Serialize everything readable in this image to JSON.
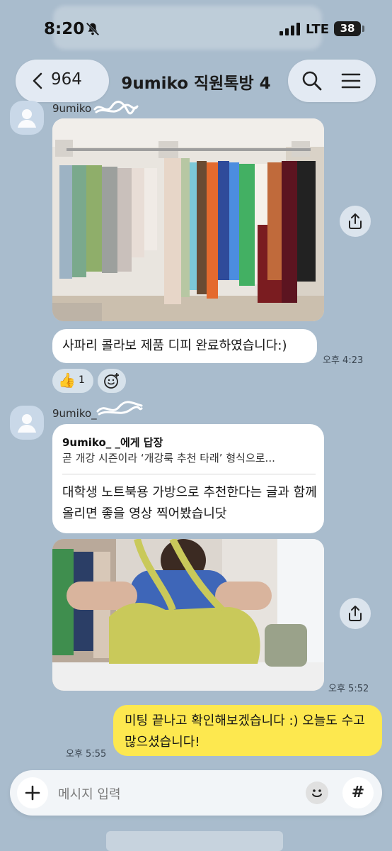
{
  "status_bar": {
    "time": "8:20",
    "network": "LTE",
    "battery": "38"
  },
  "header": {
    "back_count": "964",
    "title": "9umiko 직원톡방 4"
  },
  "messages": {
    "msg1": {
      "sender": "9umiko",
      "text": "사파리 콜라보 제품 디피 완료하였습니다:)",
      "time": "오후 4:23",
      "reaction": {
        "emoji": "👍",
        "count": "1"
      }
    },
    "msg2": {
      "sender": "9umiko_",
      "reply_to": "9umiko_     _에게 답장",
      "reply_quote": "곧 개강 시즌이라 ‘개강룩 추천 타래’ 형식으로...",
      "text": "대학생 노트북용 가방으로 추천한다는 글과 함께 올리면 좋을 영상 찍어봤습니닷",
      "time": "오후 5:52"
    },
    "msg3": {
      "text": "미팅 끝나고 확인해보겠습니다 :) 오늘도 수고 많으셨습니다!",
      "time": "오후 5:55"
    }
  },
  "input": {
    "placeholder": "메시지 입력",
    "hash_label": "#"
  },
  "colors": {
    "background": "#a9bccd",
    "my_bubble": "#fde84f",
    "their_bubble": "#ffffff"
  }
}
